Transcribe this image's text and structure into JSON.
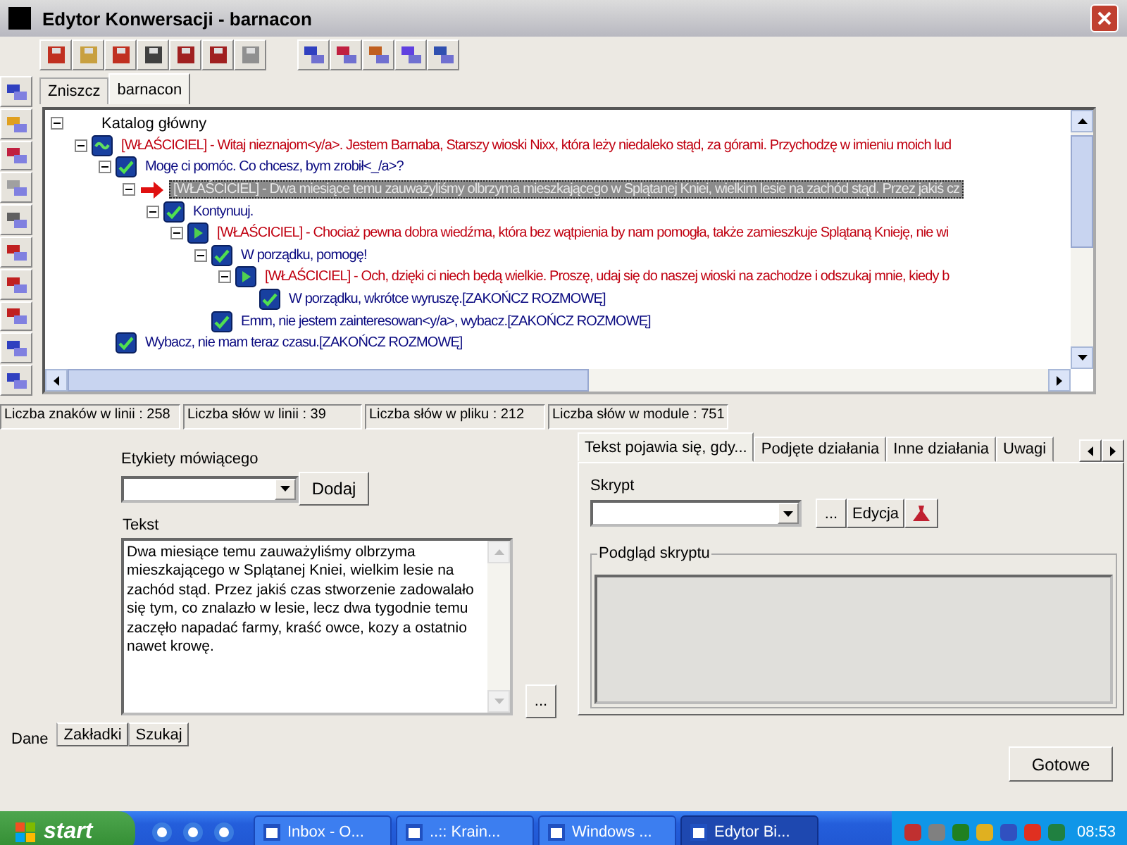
{
  "window": {
    "title": "Edytor Konwersacji - barnacon"
  },
  "file_tabs": [
    {
      "label": "Zniszcz",
      "selected": false
    },
    {
      "label": "barnacon",
      "selected": true
    }
  ],
  "tree": {
    "root": {
      "label": "Katalog główny",
      "expanded": true,
      "children": [
        {
          "kind": "greeting",
          "text": "[WŁAŚCICIEL] - Witaj nieznajom<y/a>. Jestem Barnaba, Starszy wioski Nixx, która leży niedaleko stąd, za górami. Przychodzę w imieniu moich lud",
          "selected": false,
          "expanded": true,
          "children": [
            {
              "kind": "player",
              "text": "Mogę ci pomóc. Co chcesz, bym zrobił<_/a>?",
              "selected": false,
              "expanded": true,
              "children": [
                {
                  "kind": "link",
                  "text": "[WŁAŚCICIEL] - Dwa miesiące temu zauważyliśmy olbrzyma mieszkającego w Splątanej Kniei, wielkim lesie na zachód stąd. Przez jakiś cz",
                  "selected": true,
                  "expanded": true,
                  "children": [
                    {
                      "kind": "player",
                      "text": "Kontynuuj.",
                      "selected": false,
                      "expanded": true,
                      "children": [
                        {
                          "kind": "npc",
                          "text": "[WŁAŚCICIEL] - Chociaż pewna dobra wiedźma, która bez wątpienia by nam pomogła, także zamieszkuje Splątaną Knieję, nie wi",
                          "selected": false,
                          "expanded": true,
                          "children": [
                            {
                              "kind": "player",
                              "text": "W porządku, pomogę!",
                              "selected": false,
                              "expanded": true,
                              "children": [
                                {
                                  "kind": "npc",
                                  "text": "[WŁAŚCICIEL] - Och, dzięki ci niech będą wielkie. Proszę, udaj się do naszej wioski na zachodze i odszukaj mnie, kiedy b",
                                  "selected": false,
                                  "expanded": true,
                                  "children": [
                                    {
                                      "kind": "player",
                                      "text": "W porządku, wkrótce wyruszę.[ZAKOŃCZ ROZMOWĘ]",
                                      "selected": false
                                    }
                                  ]
                                }
                              ]
                            },
                            {
                              "kind": "player",
                              "text": "Emm, nie jestem zainteresowan<y/a>, wybacz.[ZAKOŃCZ ROZMOWĘ]",
                              "selected": false
                            }
                          ]
                        }
                      ]
                    }
                  ]
                }
              ]
            },
            {
              "kind": "player",
              "text": "Wybacz, nie mam teraz czasu.[ZAKOŃCZ ROZMOWĘ]",
              "selected": false
            }
          ]
        }
      ]
    }
  },
  "status_bar": [
    "Liczba znaków w linii : 258",
    "Liczba słów w linii : 39",
    "Liczba słów w pliku : 212",
    "Liczba słów w module : 751"
  ],
  "speaker_labels": {
    "label": "Etykiety mówiącego",
    "button": "Dodaj"
  },
  "text_section": {
    "label": "Tekst",
    "value": "Dwa miesiące temu zauważyliśmy olbrzyma mieszkającego w Splątanej Kniei, wielkim lesie na zachód stąd. Przez jakiś czas stworzenie zadowalało się tym, co znalazło w lesie, lecz dwa tygodnie temu zaczęło napadać farmy, kraść owce, kozy a ostatnio nawet krowę.",
    "browse_button": "..."
  },
  "detail_tabs": [
    {
      "label": "Tekst pojawia się, gdy...",
      "selected": true
    },
    {
      "label": "Podjęte działania",
      "selected": false
    },
    {
      "label": "Inne działania",
      "selected": false
    },
    {
      "label": "Uwagi",
      "selected": false
    }
  ],
  "script": {
    "label": "Skrypt",
    "browse_button": "...",
    "edit_button": "Edycja",
    "preview_label": "Podgląd skryptu"
  },
  "bottom_tabs": [
    {
      "label": "Dane",
      "selected": true
    },
    {
      "label": "Zakładki",
      "selected": false
    },
    {
      "label": "Szukaj",
      "selected": false
    }
  ],
  "done_button": "Gotowe",
  "taskbar": {
    "start": "start",
    "tasks": [
      {
        "label": "Inbox - O...",
        "selected": false
      },
      {
        "label": "..:: Krain...",
        "selected": false
      },
      {
        "label": "Windows ...",
        "selected": false
      },
      {
        "label": "Edytor Bi...",
        "selected": true
      }
    ],
    "clock": "08:53"
  }
}
